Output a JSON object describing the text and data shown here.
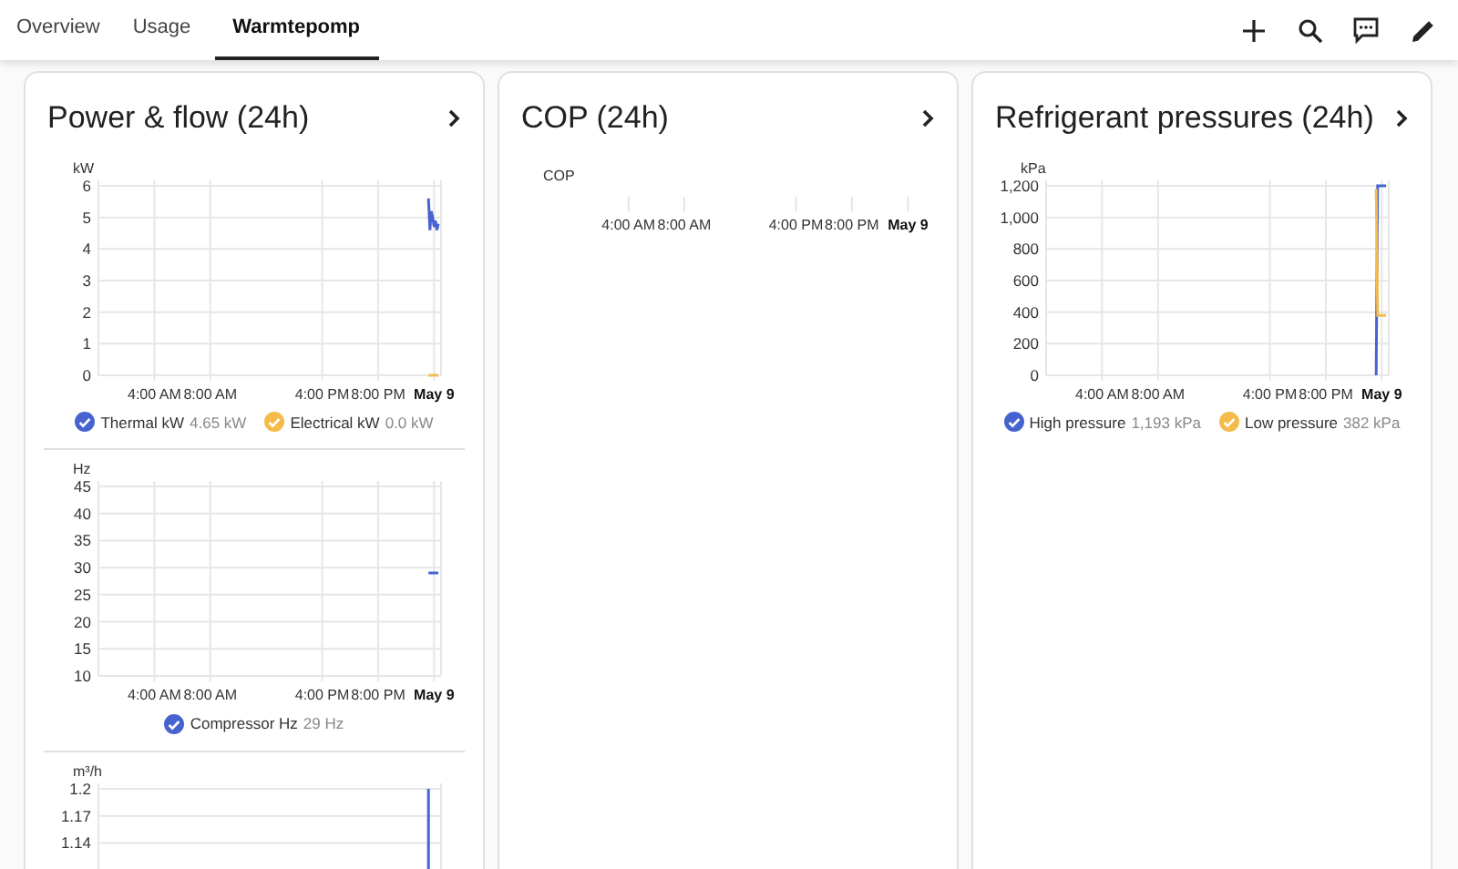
{
  "tabs": [
    {
      "label": "Overview",
      "selected": false
    },
    {
      "label": "Usage",
      "selected": false
    },
    {
      "label": "Warmtepomp",
      "selected": true
    }
  ],
  "cards": [
    {
      "title": "Power & flow (24h)",
      "sections": [
        {
          "chart_data": {
            "type": "line",
            "grid": true,
            "ylabel": "kW",
            "xlim": [
              0,
              24.5
            ],
            "ylim": [
              0,
              6
            ],
            "yticks": [
              0,
              1,
              2,
              3,
              4,
              5,
              6
            ],
            "xticks": [
              {
                "value": 4,
                "label": "4:00 AM"
              },
              {
                "value": 8,
                "label": "8:00 AM"
              },
              {
                "value": 16,
                "label": "4:00 PM"
              },
              {
                "value": 20,
                "label": "8:00 PM"
              },
              {
                "value": 24,
                "label": "May 9"
              }
            ],
            "x": [
              23.6,
              23.7,
              23.8,
              23.9,
              24.0,
              24.1,
              24.2,
              24.3
            ],
            "series": [
              {
                "name": "Thermal kW",
                "color": "#4763cf",
                "values": [
                  5.6,
                  4.6,
                  5.2,
                  5.0,
                  4.7,
                  4.9,
                  4.6,
                  4.8
                ]
              },
              {
                "name": "Electrical kW",
                "color": "#f4bb4b",
                "values": [
                  0,
                  0,
                  0,
                  0,
                  0,
                  0,
                  0,
                  0
                ]
              }
            ]
          },
          "legend": [
            {
              "value": "4.65 kW",
              "checked": true
            },
            {
              "value": "0.0 kW",
              "checked": true
            }
          ]
        },
        {
          "chart_data": {
            "type": "line",
            "grid": true,
            "ylabel": "Hz",
            "xlim": [
              0,
              24.5
            ],
            "ylim": [
              10,
              45
            ],
            "yticks": [
              10,
              15,
              20,
              25,
              30,
              35,
              40,
              45
            ],
            "xticks": [
              {
                "value": 4,
                "label": "4:00 AM"
              },
              {
                "value": 8,
                "label": "8:00 AM"
              },
              {
                "value": 16,
                "label": "4:00 PM"
              },
              {
                "value": 20,
                "label": "8:00 PM"
              },
              {
                "value": 24,
                "label": "May 9"
              }
            ],
            "x": [
              23.6,
              24.3
            ],
            "series": [
              {
                "name": "Compressor Hz",
                "color": "#4763cf",
                "values": [
                  29,
                  29
                ]
              }
            ]
          },
          "legend": [
            {
              "value": "29 Hz",
              "checked": true
            }
          ]
        },
        {
          "chart_data": {
            "type": "line",
            "grid": true,
            "ylabel": "m³/h",
            "xlim": [
              0,
              24.5
            ],
            "ylim": [
              0.99,
              1.2
            ],
            "yticks": [
              1.14,
              1.17,
              1.2
            ],
            "x": [
              23.6,
              23.6
            ],
            "series": [
              {
                "color": "#4763cf",
                "values": [
                  1.2,
                  0.99
                ]
              }
            ]
          }
        }
      ]
    },
    {
      "title": "COP (24h)",
      "sections": [
        {
          "empty_chart": {
            "axis_title": "COP",
            "x_labels": [
              "4:00 AM",
              "8:00 AM",
              "4:00 PM",
              "8:00 PM",
              "May 9"
            ]
          }
        }
      ]
    },
    {
      "title": "Refrigerant pressures (24h)",
      "sections": [
        {
          "chart_data": {
            "type": "line",
            "grid": true,
            "ylabel": "kPa",
            "xlim": [
              0,
              24.5
            ],
            "ylim": [
              0,
              1200
            ],
            "yticks": [
              0,
              {
                "value": 200,
                "label": "200"
              },
              {
                "value": 400,
                "label": "400"
              },
              {
                "value": 600,
                "label": "600"
              },
              {
                "value": 800,
                "label": "800"
              },
              {
                "value": 1000,
                "label": "1,000"
              },
              {
                "value": 1200,
                "label": "1,200"
              }
            ],
            "xticks": [
              {
                "value": 4,
                "label": "4:00 AM"
              },
              {
                "value": 8,
                "label": "8:00 AM"
              },
              {
                "value": 16,
                "label": "4:00 PM"
              },
              {
                "value": 20,
                "label": "8:00 PM"
              },
              {
                "value": 24,
                "label": "May 9"
              }
            ],
            "x": [
              23.6,
              23.7,
              24.3
            ],
            "series": [
              {
                "name": "High pressure",
                "color": "#4763cf",
                "values": [
                  0,
                  1200,
                  1200
                ]
              },
              {
                "name": "Low pressure",
                "color": "#f4bb4b",
                "values": [
                  1180,
                  380,
                  380
                ]
              }
            ]
          },
          "legend": [
            {
              "value": "1,193 kPa",
              "checked": true
            },
            {
              "value": "382 kPa",
              "checked": true
            }
          ]
        }
      ]
    }
  ]
}
